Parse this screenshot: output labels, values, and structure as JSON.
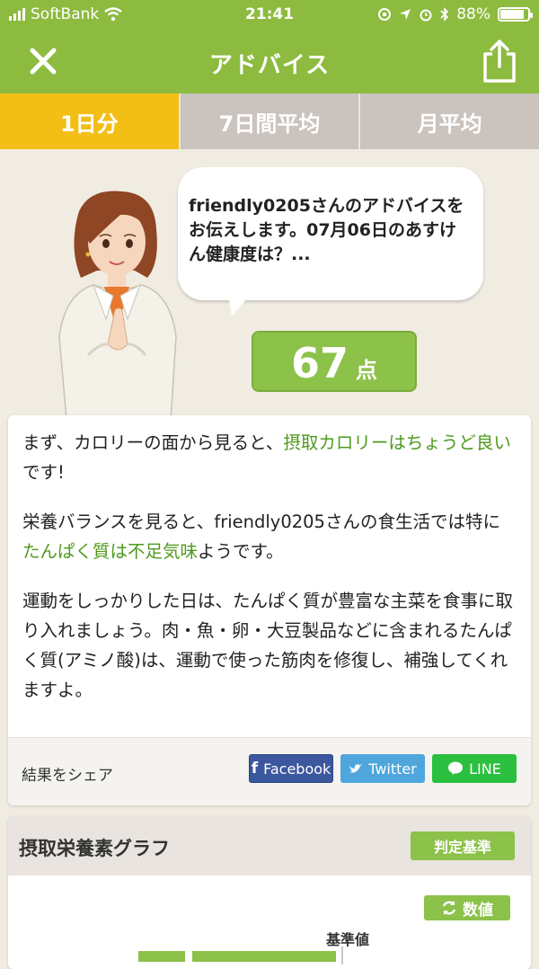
{
  "status": {
    "carrier": "SoftBank",
    "time": "21:41",
    "battery": "88%"
  },
  "header": {
    "title": "アドバイス"
  },
  "tabs": [
    {
      "label": "1日分",
      "active": true
    },
    {
      "label": "7日間平均",
      "active": false
    },
    {
      "label": "月平均",
      "active": false
    }
  ],
  "bubble": {
    "text": "friendly0205さんのアドバイスをお伝えします。07月06日のあすけん健康度は？..."
  },
  "score": {
    "value": "67",
    "unit": "点"
  },
  "advice": {
    "p1_a": "まず、カロリーの面から見ると、",
    "p1_hl": "摂取カロリーはちょうど良い",
    "p1_b": "です!",
    "p2_a": "栄養バランスを見ると、friendly0205さんの食生活では特に",
    "p2_hl": "たんぱく質は不足気味",
    "p2_b": "ようです。",
    "p3": "運動をしっかりした日は、たんぱく質が豊富な主菜を食事に取り入れましょう。肉・魚・卵・大豆製品などに含まれるたんぱく質(アミノ酸)は、運動で使った筋肉を修復し、補強してくれますよ。"
  },
  "share": {
    "label": "結果をシェア",
    "facebook": "Facebook",
    "twitter": "Twitter",
    "line": "LINE"
  },
  "nutrients": {
    "title": "摂取栄養素グラフ",
    "criteria_button": "判定基準",
    "value_button": "数値",
    "reference_label": "基準値"
  },
  "colors": {
    "header": "#8dbb3f",
    "active_tab": "#f3be16",
    "highlight": "#4f9a1d"
  }
}
